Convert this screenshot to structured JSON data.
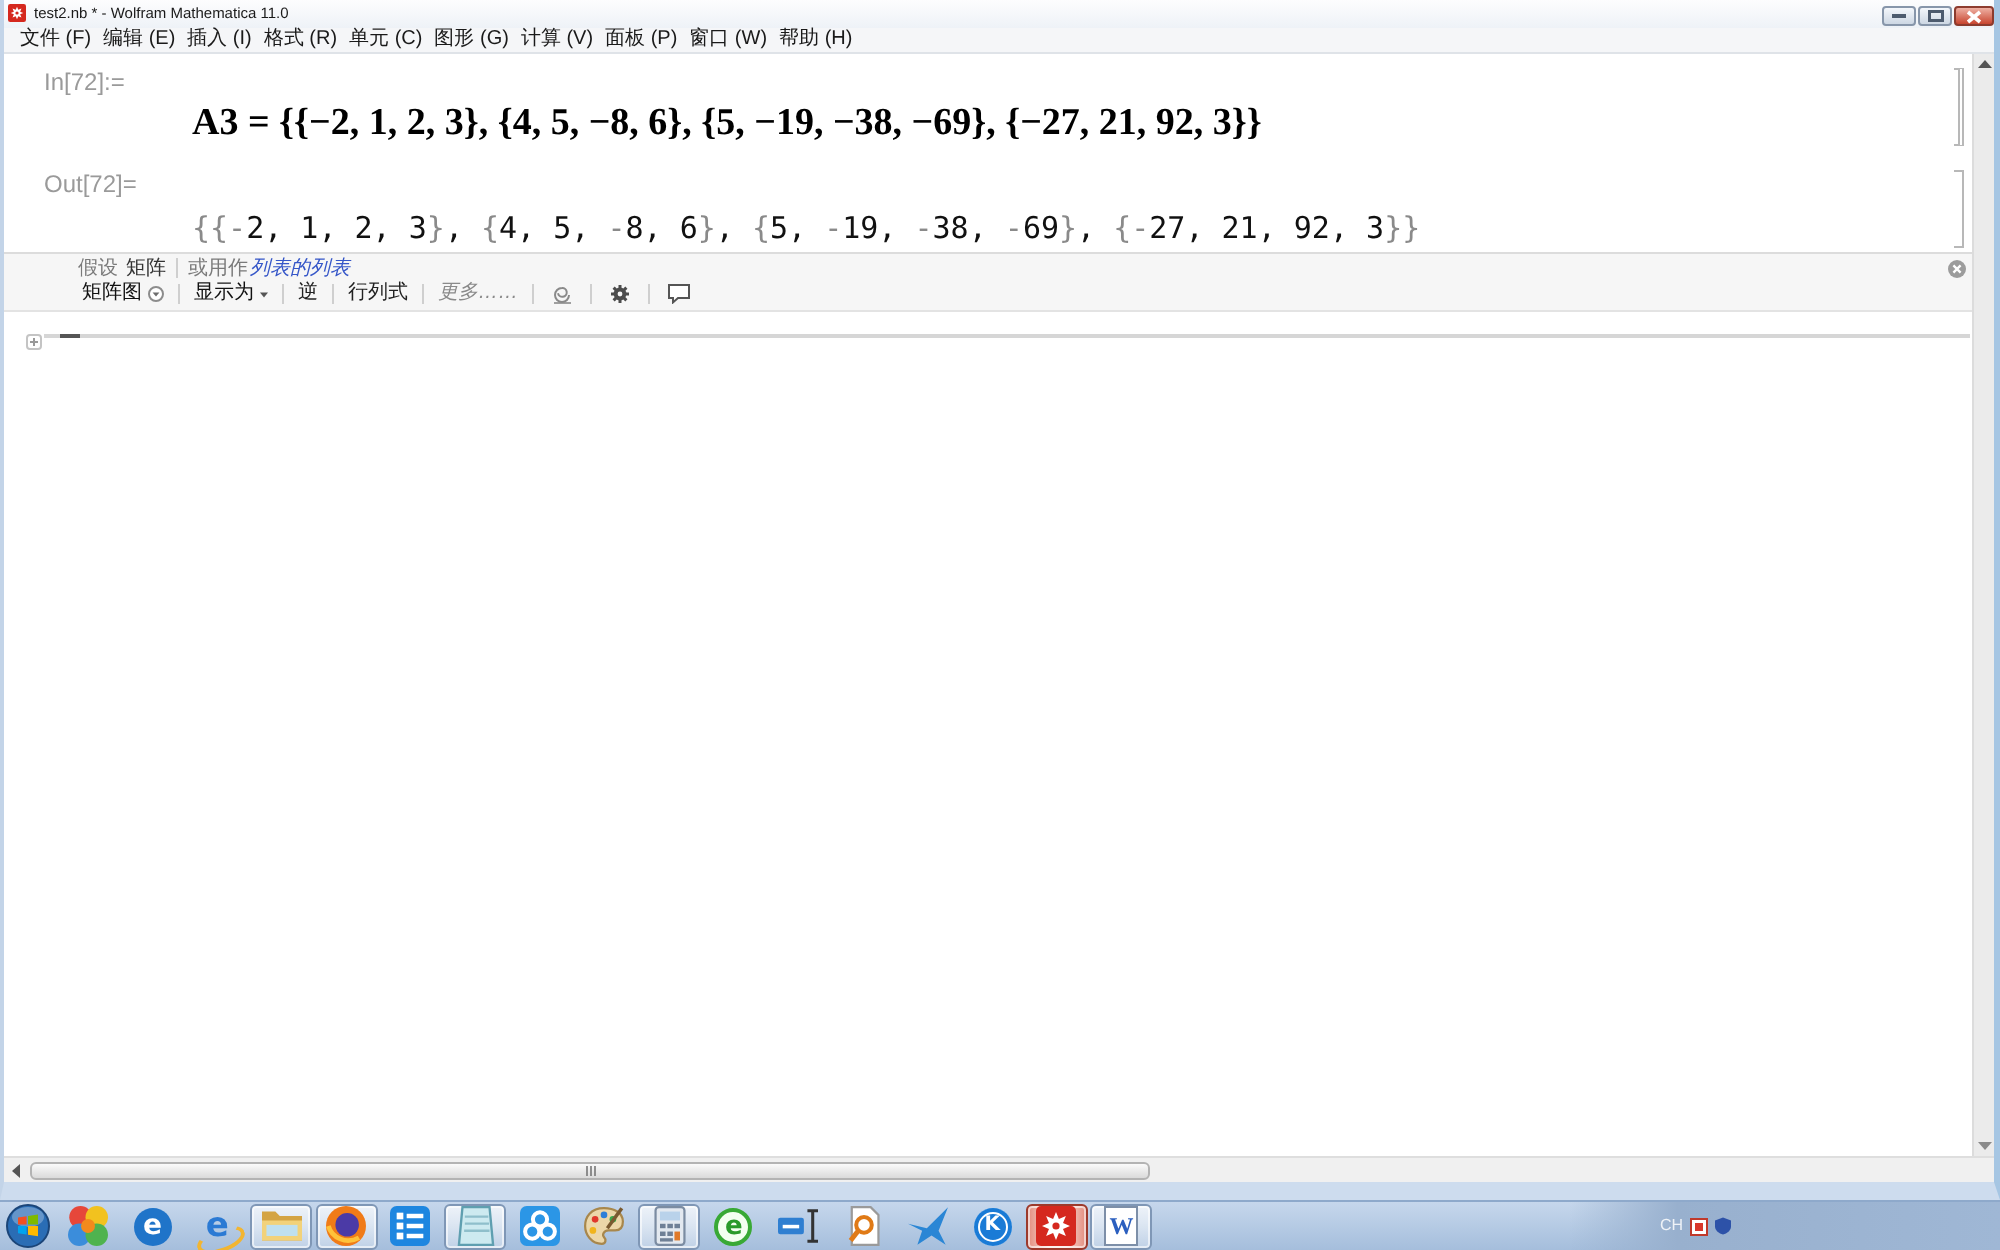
{
  "window": {
    "title": "test2.nb * - Wolfram Mathematica 11.0"
  },
  "menu": [
    "文件 (F)",
    "编辑 (E)",
    "插入 (I)",
    "格式 (R)",
    "单元 (C)",
    "图形 (G)",
    "计算 (V)",
    "面板 (P)",
    "窗口 (W)",
    "帮助 (H)"
  ],
  "cells": [
    {
      "kind": "input",
      "label": "In[72]:=",
      "text": "A3 = {{−2, 1, 2, 3}, {4, 5, −8, 6}, {5, −19, −38, −69}, {−27, 21, 92, 3}}"
    },
    {
      "kind": "output",
      "label": "Out[72]=",
      "text": "{{-2, 1, 2, 3}, {4, 5, -8, 6}, {5, -19, -38, -69}, {-27, 21, 92, 3}}"
    }
  ],
  "suggestions_bar": {
    "assumption": {
      "prefix": "假设",
      "value": "矩阵",
      "alternative_prefix": "或用作",
      "alternative": "列表的列表"
    },
    "actions": [
      {
        "kind": "dropdown",
        "label": "矩阵图"
      },
      {
        "kind": "menu",
        "label": "显示为"
      },
      {
        "kind": "command",
        "label": "逆"
      },
      {
        "kind": "command",
        "label": "行列式"
      },
      {
        "kind": "more",
        "label": "更多……"
      },
      {
        "kind": "swirl"
      },
      {
        "kind": "settings"
      },
      {
        "kind": "feedback"
      }
    ]
  },
  "taskbar": {
    "items": [
      {
        "kind": "orbs",
        "running": false,
        "selected": false
      },
      {
        "kind": "ebadge",
        "glyph": "e",
        "running": false,
        "selected": false
      },
      {
        "kind": "eorbit",
        "glyph": "e",
        "running": false,
        "selected": false
      },
      {
        "kind": "folder",
        "running": true,
        "selected": false
      },
      {
        "kind": "globe",
        "running": true,
        "selected": false
      },
      {
        "kind": "list",
        "running": false,
        "selected": false
      },
      {
        "kind": "notepad",
        "running": true,
        "selected": false
      },
      {
        "kind": "rings",
        "running": false,
        "selected": false
      },
      {
        "kind": "palette",
        "running": false,
        "selected": false
      },
      {
        "kind": "calculator",
        "running": true,
        "selected": false
      },
      {
        "kind": "egreen",
        "glyph": "e",
        "running": false,
        "selected": false
      },
      {
        "kind": "inputbox",
        "running": false,
        "selected": false
      },
      {
        "kind": "finder",
        "running": false,
        "selected": false
      },
      {
        "kind": "bird",
        "running": false,
        "selected": false
      },
      {
        "kind": "kbadge",
        "glyph": "K",
        "running": false,
        "selected": false
      },
      {
        "kind": "gear",
        "running": true,
        "selected": true
      },
      {
        "kind": "document",
        "glyph": "W",
        "running": true,
        "selected": false
      }
    ],
    "tray": {
      "language": "CH"
    }
  }
}
